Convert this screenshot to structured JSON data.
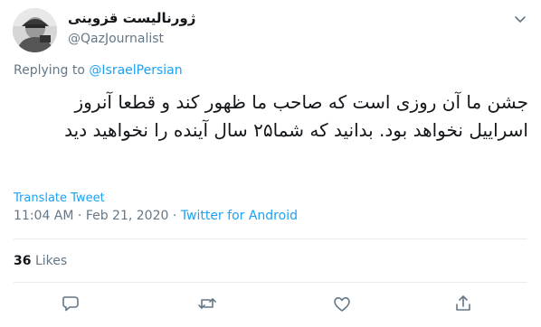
{
  "author": {
    "display_name": "ژورنالیست قزوینی",
    "handle": "@QazJournalist"
  },
  "icons": {
    "menu": "chevron-down-icon",
    "reply": "reply-icon",
    "retweet": "retweet-icon",
    "like": "heart-icon",
    "share": "share-icon"
  },
  "reply_context": {
    "prefix": "Replying to ",
    "target": "@IsraelPersian"
  },
  "tweet": {
    "text": "جشن ما آن روزی است که صاحب ما ظهور کند و قطعا آنروز اسراییل نخواهد بود. بدانید که شما۲۵ سال آینده را نخواهید دید",
    "translate_label": "Translate Tweet",
    "time": "11:04 AM",
    "separator": " · ",
    "date": "Feb 21, 2020",
    "source": "Twitter for Android"
  },
  "stats": {
    "likes_count": "36",
    "likes_label": "Likes"
  },
  "colors": {
    "link": "#1da1f2",
    "secondary": "#657786",
    "divider": "#e6ecf0"
  }
}
